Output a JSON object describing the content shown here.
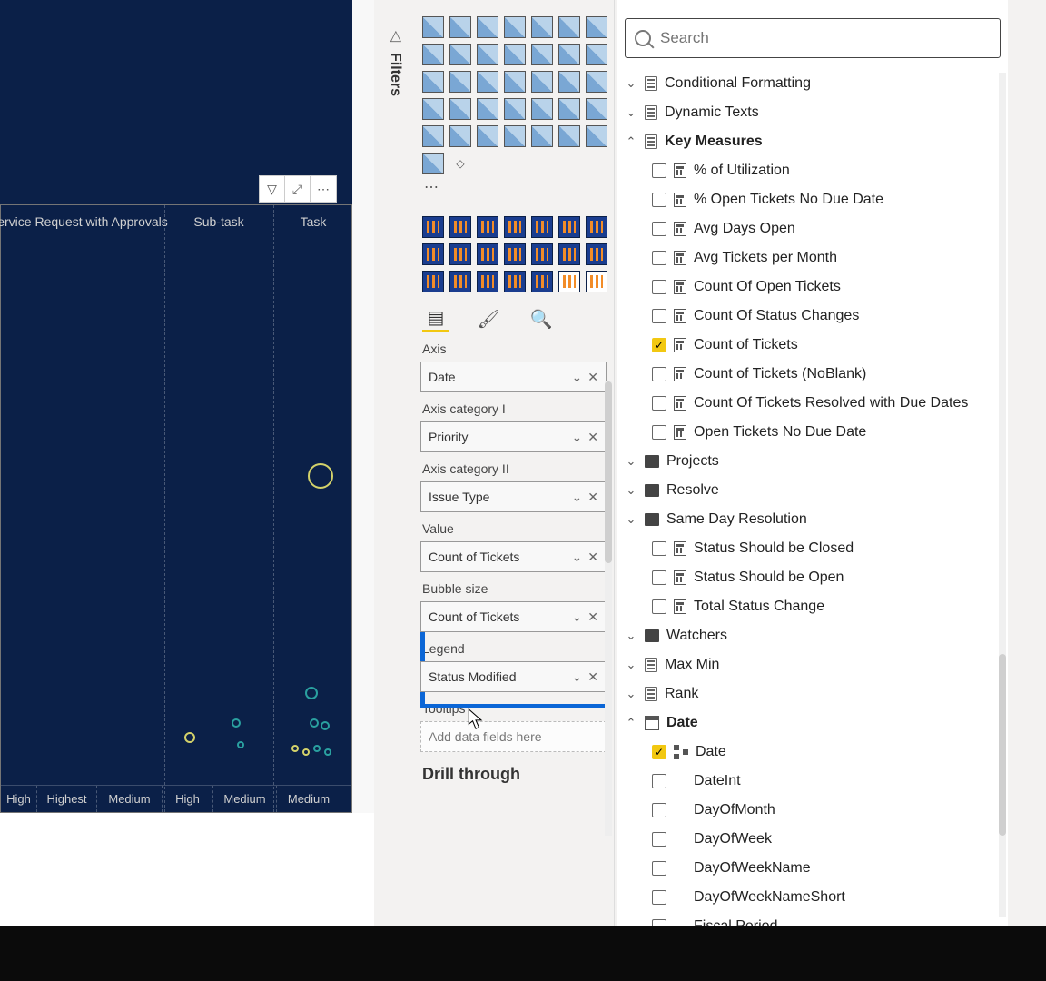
{
  "filters_label": "Filters",
  "search": {
    "placeholder": "Search"
  },
  "chart": {
    "col_headers": [
      "ervice Request with Approvals",
      "Sub-task",
      "Task"
    ],
    "axis_labels": [
      "High",
      "Highest",
      "Medium",
      "High",
      "Medium",
      "Medium"
    ]
  },
  "toolbar": {
    "filter_tip": "Filter",
    "focus_tip": "Focus",
    "more_tip": "More"
  },
  "viz": {
    "wells": {
      "axis_label": "Axis",
      "axis_value": "Date",
      "cat1_label": "Axis category I",
      "cat1_value": "Priority",
      "cat2_label": "Axis category II",
      "cat2_value": "Issue Type",
      "value_label": "Value",
      "value_value": "Count of Tickets",
      "bubble_label": "Bubble size",
      "bubble_value": "Count of Tickets",
      "legend_label": "Legend",
      "legend_value": "Status Modified",
      "tooltips_label": "Tooltips",
      "tooltips_placeholder": "Add data fields here"
    },
    "drill_label": "Drill through"
  },
  "fields": {
    "tables": {
      "cond_fmt": "Conditional Formatting",
      "dyn_text": "Dynamic Texts",
      "key_measures": "Key Measures",
      "projects": "Projects",
      "resolve": "Resolve",
      "same_day": "Same Day Resolution",
      "watchers": "Watchers",
      "max_min": "Max Min",
      "rank": "Rank",
      "date": "Date"
    },
    "km": {
      "util": "% of Utilization",
      "open_no_due": "% Open Tickets No Due Date",
      "avg_days": "Avg Days Open",
      "avg_tpm": "Avg Tickets per Month",
      "count_open": "Count Of Open Tickets",
      "count_status": "Count Of Status Changes",
      "count_tickets": "Count of Tickets",
      "count_noblank": "Count of Tickets (NoBlank)",
      "count_resolved_due": "Count Of Tickets Resolved with Due Dates",
      "open_no_due2": "Open Tickets No Due Date"
    },
    "sd": {
      "closed": "Status Should be Closed",
      "open": "Status Should be Open",
      "total": "Total Status Change"
    },
    "dt": {
      "date": "Date",
      "dateint": "DateInt",
      "dom": "DayOfMonth",
      "dow": "DayOfWeek",
      "down": "DayOfWeekName",
      "downs": "DayOfWeekNameShort",
      "fp": "Fiscal Period"
    }
  }
}
